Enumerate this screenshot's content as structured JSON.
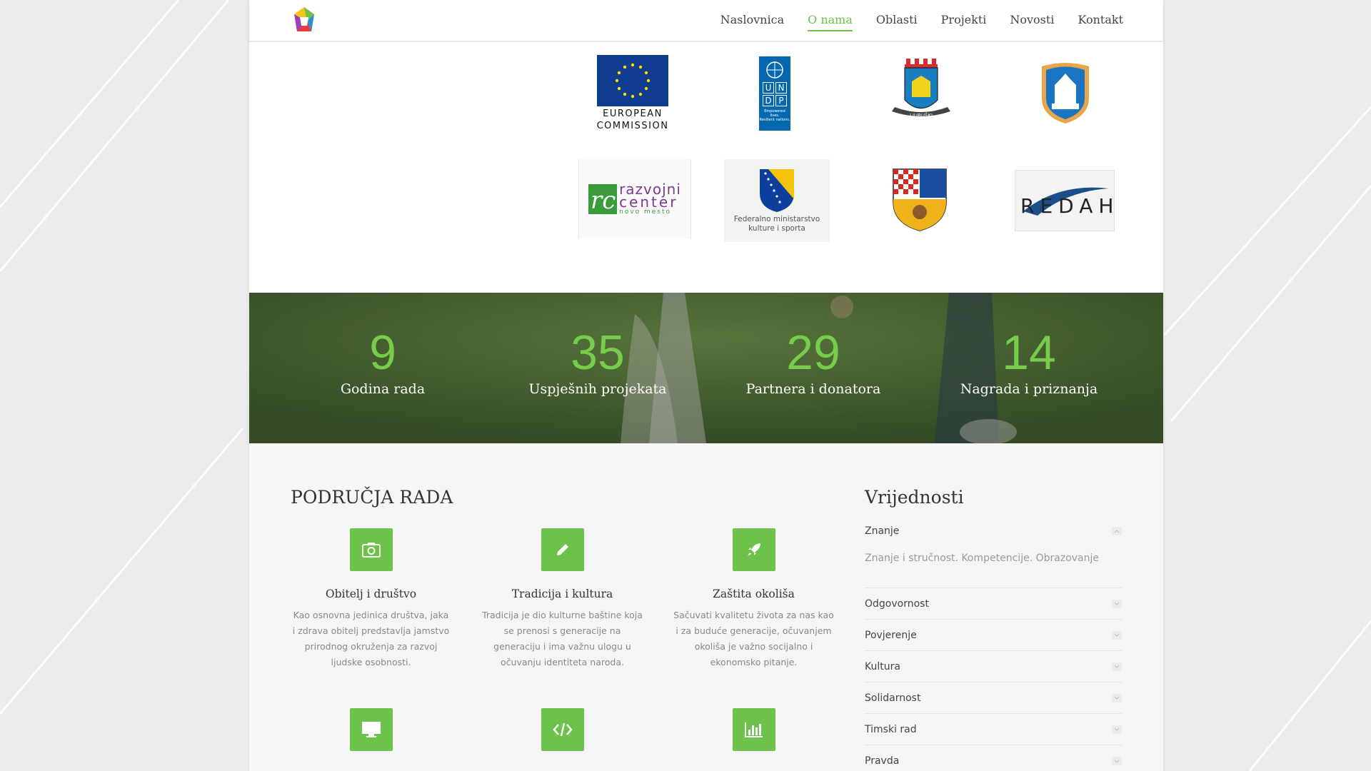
{
  "nav": {
    "items": [
      "Naslovnica",
      "O nama",
      "Oblasti",
      "Projekti",
      "Novosti",
      "Kontakt"
    ],
    "active": "O nama"
  },
  "partners": {
    "eu_line1": "EUROPEAN",
    "eu_line2": "COMMISSION",
    "undp_letters": [
      "U",
      "N",
      "D",
      "P"
    ],
    "undp_tagline1": "Empowered lives.",
    "undp_tagline2": "Resilient nations.",
    "ljubuski_banner": "LJUBUŠKI",
    "rc_line1": "razvojni",
    "rc_line2": "center",
    "rc_line3": "novo mesto",
    "fed_line1": "Federalno ministarstvo",
    "fed_line2": "kulture i sporta",
    "redah": "REDAH"
  },
  "stats": [
    {
      "number": "9",
      "label": "Godina rada"
    },
    {
      "number": "35",
      "label": "Uspješnih projekata"
    },
    {
      "number": "29",
      "label": "Partnera i donatora"
    },
    {
      "number": "14",
      "label": "Nagrada i priznanja"
    }
  ],
  "areas": {
    "title": "PODRUČJA RADA",
    "items": [
      {
        "icon": "camera-icon",
        "title": "Obitelj i društvo",
        "text": "Kao osnovna jedinica društva, jaka i zdrava obitelj predstavlja jamstvo prirodnog okruženja za razvoj ljudske osobnosti."
      },
      {
        "icon": "pencil-icon",
        "title": "Tradicija i kultura",
        "text": "Tradicija je dio kulturne baštine koja se prenosi s generacije na generaciju i ima važnu ulogu u očuvanju identiteta naroda."
      },
      {
        "icon": "rocket-icon",
        "title": "Zaštita okoliša",
        "text": "Sačuvati kvalitetu života za nas kao i za buduće generacije, očuvanjem okoliša je važno socijalno i ekonomsko pitanje."
      },
      {
        "icon": "monitor-icon",
        "title": "",
        "text": ""
      },
      {
        "icon": "code-icon",
        "title": "",
        "text": ""
      },
      {
        "icon": "bar-chart-icon",
        "title": "",
        "text": ""
      }
    ]
  },
  "values": {
    "title": "Vrijednosti",
    "items": [
      {
        "label": "Znanje",
        "body": "Znanje i stručnost. Kompetencije. Obrazovanje",
        "open": true
      },
      {
        "label": "Odgovornost"
      },
      {
        "label": "Povjerenje"
      },
      {
        "label": "Kultura"
      },
      {
        "label": "Solidarnost"
      },
      {
        "label": "Timski rad"
      },
      {
        "label": "Pravda"
      }
    ]
  },
  "colors": {
    "accent": "#6cc24a",
    "stat_number": "#78cc4c"
  }
}
